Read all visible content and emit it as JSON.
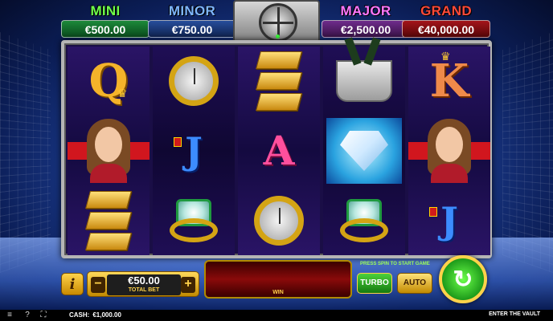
{
  "jackpots": {
    "mini": {
      "title": "MINI",
      "value": "€500.00"
    },
    "minor": {
      "title": "MINOR",
      "value": "€750.00"
    },
    "major": {
      "title": "MAJOR",
      "value": "€2,500.00"
    },
    "grand": {
      "title": "GRAND",
      "value": "€40,000.00"
    }
  },
  "reels": [
    [
      "queen",
      "woman",
      "gold-bars"
    ],
    [
      "gold-watch",
      "jack",
      "emerald-ring"
    ],
    [
      "gold-bars",
      "ace",
      "gold-watch"
    ],
    [
      "champagne-bucket",
      "diamond",
      "emerald-ring"
    ],
    [
      "king",
      "woman",
      "jack"
    ]
  ],
  "symbols": {
    "queen": "Q",
    "king": "K",
    "jack": "J",
    "ace": "A"
  },
  "controls": {
    "info_label": "i",
    "bet_minus": "−",
    "bet_plus": "+",
    "bet_amount": "€50.00",
    "bet_label": "TOTAL BET",
    "win_label": "WIN",
    "hint": "PRESS SPIN TO START GAME",
    "turbo": "TURBO",
    "auto": "AUTO",
    "spin_icon": "↻"
  },
  "status_bar": {
    "cash_label": "CASH:",
    "cash_value": "€1,000.00",
    "game_name": "ENTER THE VAULT",
    "menu_icon": "≡",
    "help_icon": "?",
    "fullscreen_icon": "⛶"
  }
}
